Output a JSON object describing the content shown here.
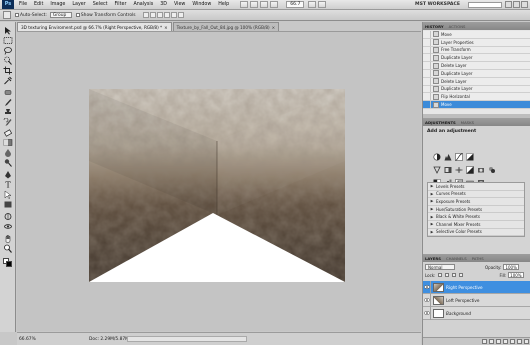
{
  "app": {
    "logo": "Ps",
    "menu": [
      "File",
      "Edit",
      "Image",
      "Layer",
      "Select",
      "Filter",
      "Analysis",
      "3D",
      "View",
      "Window",
      "Help"
    ],
    "zoom": "66.7",
    "workspace": "MST WORKSPACE"
  },
  "options": {
    "auto_select_label": "Auto-Select:",
    "auto_select_value": "Group",
    "transform_label": "Show Transform Controls"
  },
  "documents": {
    "tabs": [
      {
        "label": "3D texturing Enviroment.psd @ 66.7% (Right Perspective, RGB/8) *",
        "close": "×"
      },
      {
        "label": "Texture_by_Fall_Out_84.jpg @ 100% (RGB/8)",
        "close": "×"
      }
    ]
  },
  "status": {
    "zoom": "66.67%",
    "doc_info": "Doc: 2.29M/5.87M"
  },
  "history": {
    "tabs": [
      "HISTORY",
      "ACTIONS"
    ],
    "items": [
      "Move",
      "Layer Properties",
      "Free Transform",
      "Duplicate Layer",
      "Delete Layer",
      "Duplicate Layer",
      "Delete Layer",
      "Duplicate Layer",
      "Flip Horizontal",
      "Move"
    ]
  },
  "adjustments": {
    "tabs": [
      "ADJUSTMENTS",
      "MASKS"
    ],
    "title": "Add an adjustment",
    "presets": [
      "Levels Presets",
      "Curves Presets",
      "Exposure Presets",
      "Hue/Saturation Presets",
      "Black & White Presets",
      "Channel Mixer Presets",
      "Selective Color Presets"
    ]
  },
  "layers": {
    "tabs": [
      "LAYERS",
      "CHANNELS",
      "PATHS"
    ],
    "blend_mode": "Normal",
    "opacity_label": "Opacity:",
    "opacity": "100%",
    "lock_label": "Lock:",
    "fill_label": "Fill:",
    "fill": "100%",
    "items": [
      {
        "name": "Right Perspective"
      },
      {
        "name": "Left Perspective"
      },
      {
        "name": "Background"
      }
    ]
  },
  "icons": {
    "tools": [
      "move-tool-icon",
      "marquee-tool-icon",
      "lasso-tool-icon",
      "quick-select-tool-icon",
      "crop-tool-icon",
      "eyedropper-tool-icon",
      "healing-brush-tool-icon",
      "brush-tool-icon",
      "clone-stamp-tool-icon",
      "history-brush-tool-icon",
      "eraser-tool-icon",
      "gradient-tool-icon",
      "blur-tool-icon",
      "dodge-tool-icon",
      "pen-tool-icon",
      "type-tool-icon",
      "path-select-tool-icon",
      "shape-tool-icon",
      "3d-rotate-tool-icon",
      "3d-orbit-tool-icon",
      "hand-tool-icon",
      "zoom-tool-icon"
    ]
  },
  "colors": {
    "selection": "#3f8fe0",
    "history_selection": "#3c8bd9",
    "panel_bg": "#d4d4d4"
  }
}
